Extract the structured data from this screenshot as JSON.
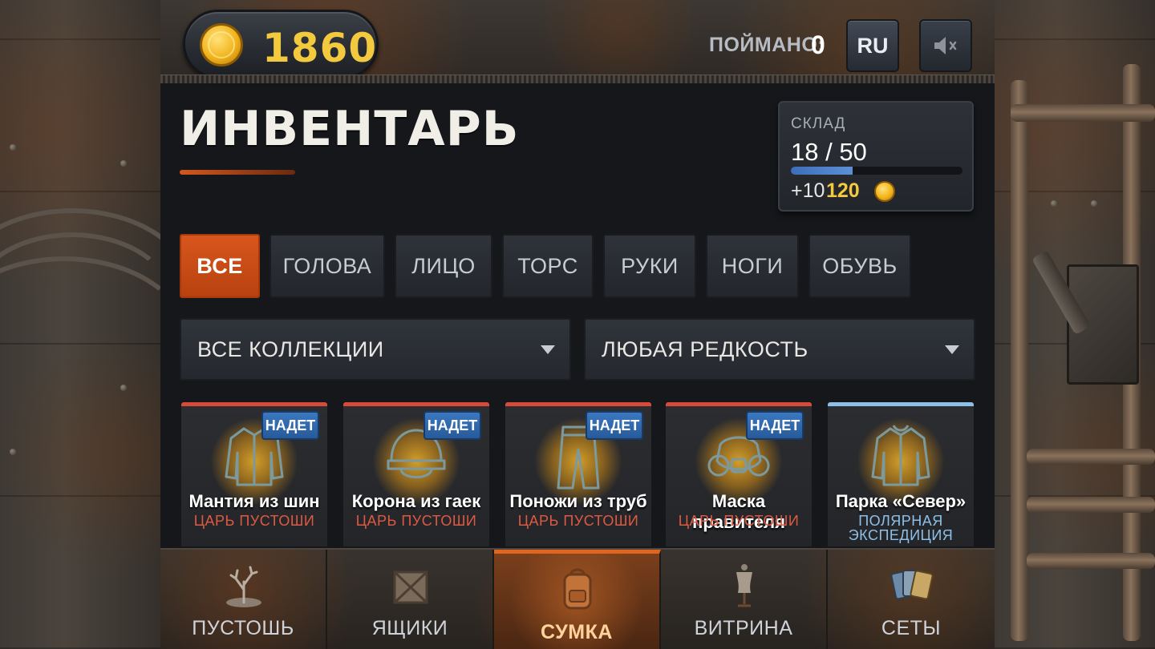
{
  "header": {
    "coins": "1860",
    "caught_label": "ПОЙМАНО:",
    "caught_value": "0",
    "language_button": "RU",
    "mute_icon": "speaker-muted-icon"
  },
  "page": {
    "title": "ИНВЕНТАРЬ"
  },
  "storage": {
    "label": "СКЛАД",
    "value": "18 / 50",
    "fill_fraction": 0.36,
    "upgrade_amount": "+10",
    "upgrade_price": "120"
  },
  "tabs": [
    {
      "label": "ВСЕ",
      "active": true
    },
    {
      "label": "ГОЛОВА",
      "active": false
    },
    {
      "label": "ЛИЦО",
      "active": false
    },
    {
      "label": "ТОРС",
      "active": false
    },
    {
      "label": "РУКИ",
      "active": false
    },
    {
      "label": "НОГИ",
      "active": false
    },
    {
      "label": "ОБУВЬ",
      "active": false
    }
  ],
  "filters": {
    "collection": "ВСЕ КОЛЛЕКЦИИ",
    "rarity": "ЛЮБАЯ РЕДКОСТЬ"
  },
  "items": [
    {
      "name": "Мантия из шин",
      "collection": "ЦАРЬ ПУСТОШИ",
      "badge": "НАДЕТ",
      "icon": "jacket-icon",
      "rarity_color": "#d84b3b"
    },
    {
      "name": "Корона из гаек",
      "collection": "ЦАРЬ ПУСТОШИ",
      "badge": "НАДЕТ",
      "icon": "helmet-icon",
      "rarity_color": "#d84b3b"
    },
    {
      "name": "Поножи из труб",
      "collection": "ЦАРЬ ПУСТОШИ",
      "badge": "НАДЕТ",
      "icon": "pants-icon",
      "rarity_color": "#d84b3b"
    },
    {
      "name": "Маска правителя",
      "collection": "ЦАРЬ ПУСТОШИ",
      "badge": "НАДЕТ",
      "icon": "gas-mask-icon",
      "rarity_color": "#d84b3b"
    },
    {
      "name": "Парка «Север»",
      "collection_line1": "ПОЛЯРНАЯ",
      "collection_line2": "ЭКСПЕДИЦИЯ",
      "icon": "jacket-icon",
      "rarity_color": "#8cc0e8"
    }
  ],
  "nav": [
    {
      "label": "ПУСТОШЬ",
      "icon": "dead-tree-icon",
      "active": false
    },
    {
      "label": "ЯЩИКИ",
      "icon": "crate-icon",
      "active": false
    },
    {
      "label": "СУМКА",
      "icon": "backpack-icon",
      "active": true
    },
    {
      "label": "ВИТРИНА",
      "icon": "mannequin-icon",
      "active": false
    },
    {
      "label": "СЕТЫ",
      "icon": "cards-icon",
      "active": false
    }
  ]
}
